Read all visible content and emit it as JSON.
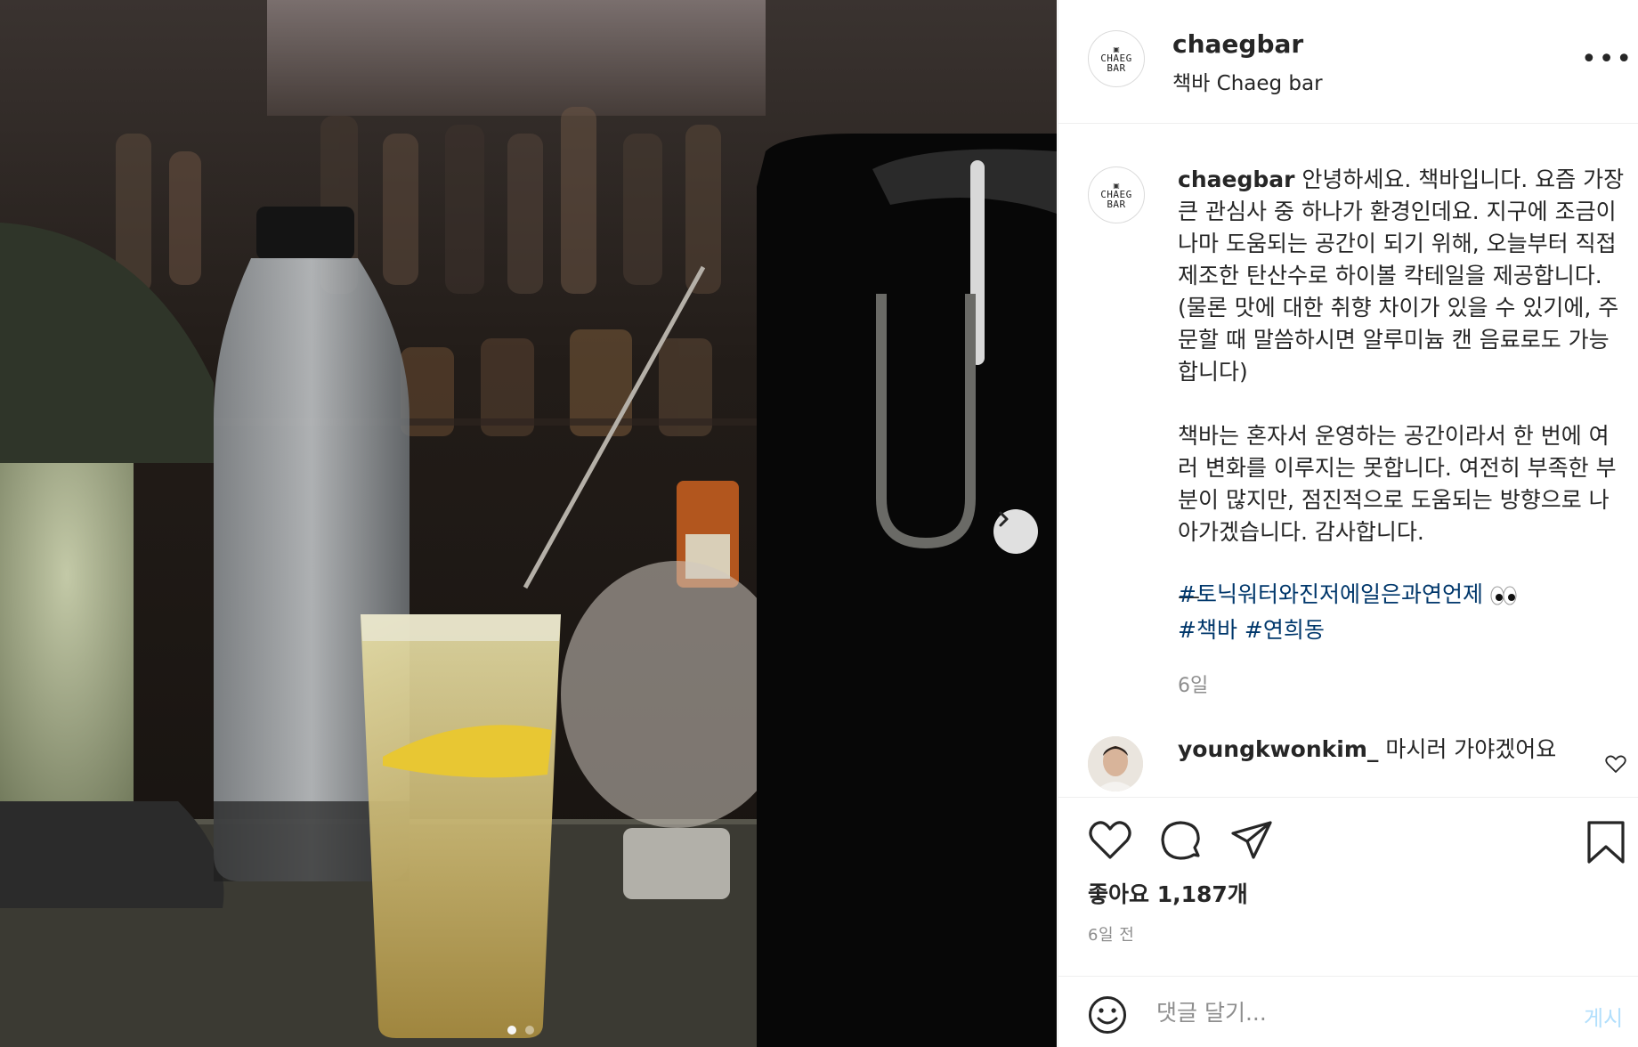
{
  "post": {
    "username": "chaegbar",
    "subtitle": "책바 Chaeg bar",
    "more_label": "•••",
    "logo": {
      "line1": "CHAEG",
      "line2": "BAR",
      "glyph": "▣"
    },
    "caption_user": "chaegbar",
    "caption_text": " 안녕하세요. 책바입니다. 요즘 가장 큰 관심사 중 하나가 환경인데요. 지구에 조금이나마 도움되는 공간이 되기 위해, 오늘부터 직접 제조한 탄산수로 하이볼 칵테일을 제공합니다. (물론 맛에 대한 취향 차이가 있을 수 있기에, 주문할 때 말씀하시면 알루미늄 캔 음료로도 가능합니다)\n\n책바는 혼자서 운영하는 공간이라서 한 번에 여러 변화를 이루지는 못합니다. 여전히 부족한 부분이 많지만, 점진적으로 도움되는 방향으로 나아가겠습니다. 감사합니다.\n\n—",
    "hashtags": [
      "#토닉워터와진저에일은과연언제",
      "#책바",
      "#연희동"
    ],
    "hashtag_emoji": "👀",
    "caption_age": "6일",
    "comment": {
      "username": "youngkwonkim_",
      "text": "마시러 가야겠어요"
    },
    "likes_text": "좋아요 1,187개",
    "posted_ago": "6일 전",
    "comment_placeholder": "댓글 달기...",
    "post_button": "게시"
  },
  "carousel": {
    "current": 1,
    "total": 2
  },
  "colors": {
    "link": "#00376b",
    "muted": "#8e8e8e",
    "post_disabled": "#b2dffc",
    "border": "#efefef"
  },
  "icons": [
    "chevron-right-icon",
    "more-icon",
    "heart-icon",
    "comment-icon",
    "share-icon",
    "bookmark-icon",
    "smile-icon"
  ]
}
